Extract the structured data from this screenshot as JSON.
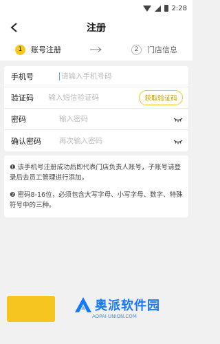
{
  "status_bar": {
    "time": "2:28"
  },
  "header": {
    "title": "注册"
  },
  "steps": [
    {
      "number": "1",
      "label": "账号注册"
    },
    {
      "number": "2",
      "label": "门店信息"
    }
  ],
  "form": {
    "phone": {
      "label": "手机号",
      "placeholder": "请输入手机号码"
    },
    "code": {
      "label": "验证码",
      "placeholder": "输入短信验证码",
      "button": "获取验证码"
    },
    "password": {
      "label": "密码",
      "placeholder": "输入密码"
    },
    "confirm": {
      "label": "确认密码",
      "placeholder": "再次输入密码"
    }
  },
  "notes": [
    "❶ 该手机号注册成功后即代表门店负责人账号，子账号请登录后去员工管理进行添加。",
    "❷ 密码8-16位，必须包含大写字母、小写字母、数字、特殊符号中的三种。"
  ],
  "watermark": {
    "text": "奥派软件园",
    "sub": "AOPAI·UNION.COM"
  },
  "colors": {
    "accent": "#f6c51f",
    "background": "#f1f1f1"
  }
}
